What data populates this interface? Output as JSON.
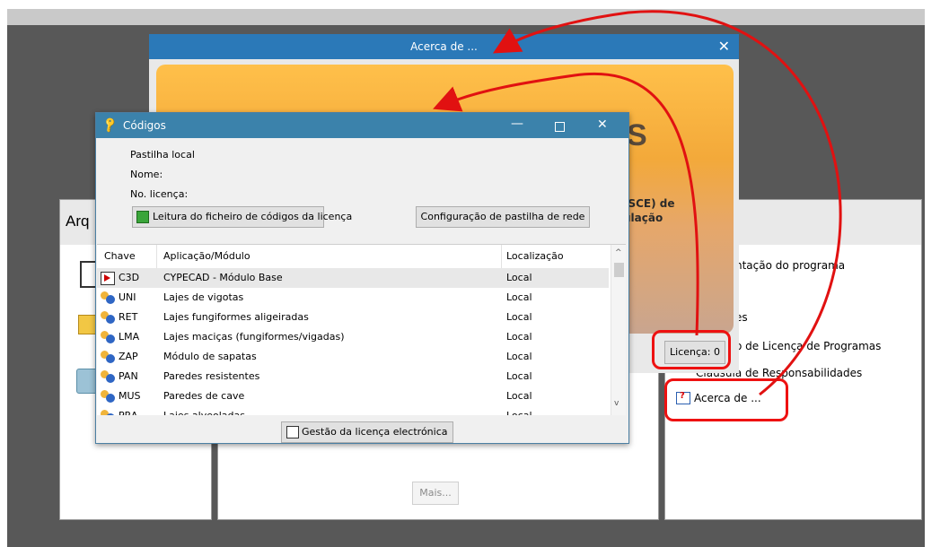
{
  "left_panel": {
    "title": "Arq"
  },
  "middle_panel": {
    "more_button": "Mais..."
  },
  "right_panel": {
    "items": [
      "ntação do programa",
      "es",
      "o de Licença de Programas",
      "Cláusula de Responsabilidades",
      "Acerca de ..."
    ]
  },
  "about_window": {
    "title": "Acerca de ...",
    "banner_text_1": "(SCE) de",
    "banner_text_2": "ulação",
    "banner_big_letter": "S",
    "license_button": "Licença: 0"
  },
  "codes_window": {
    "title": "Códigos",
    "local_key_label": "Pastilha local",
    "name_label": "Nome:",
    "license_no_label": "No. licença:",
    "read_file_button": "Leitura do ficheiro de códigos da licença",
    "network_button": "Configuração de pastilha de rede",
    "columns": [
      "Chave",
      "Aplicação/Módulo",
      "Localização"
    ],
    "rows": [
      {
        "key": "C3D",
        "module": "CYPECAD - Módulo Base",
        "location": "Local"
      },
      {
        "key": "UNI",
        "module": "Lajes de vigotas",
        "location": "Local"
      },
      {
        "key": "RET",
        "module": "Lajes fungiformes aligeiradas",
        "location": "Local"
      },
      {
        "key": "LMA",
        "module": "Lajes maciças (fungiformes/vigadas)",
        "location": "Local"
      },
      {
        "key": "ZAP",
        "module": "Módulo de sapatas",
        "location": "Local"
      },
      {
        "key": "PAN",
        "module": "Paredes resistentes",
        "location": "Local"
      },
      {
        "key": "MUS",
        "module": "Paredes de cave",
        "location": "Local"
      },
      {
        "key": "PRA",
        "module": "Lajes alveoladas",
        "location": "Local"
      }
    ],
    "electronic_license_button": "Gestão da licença electrónica"
  },
  "colors": {
    "annotation": "#e11111",
    "about_titlebar": "#2b79b8",
    "codes_titlebar": "#3b82ab",
    "banner": "#f3a93a"
  }
}
